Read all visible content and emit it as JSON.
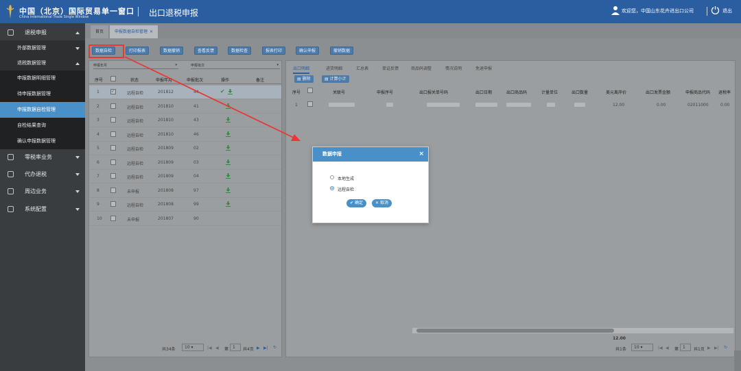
{
  "header": {
    "title": "中国（北京）国际贸易单一窗口",
    "subtitle": "China International Trade Single Window",
    "module": "出口退税申报",
    "welcome": "欢迎您，中国山东花卉进出口公司",
    "logout": "退出"
  },
  "sidebar": {
    "items": [
      {
        "label": "退税申报"
      },
      {
        "label": "外部数据管理"
      },
      {
        "label": "退税数据管理"
      },
      {
        "label": "申报数据明细管理"
      },
      {
        "label": "待申报数据管理"
      },
      {
        "label": "申报数据自检管理"
      },
      {
        "label": "自检结果查询"
      },
      {
        "label": "确认申报数据管理"
      },
      {
        "label": "零税率业务"
      },
      {
        "label": "代办退税"
      },
      {
        "label": "周边业务"
      },
      {
        "label": "系统配置"
      }
    ]
  },
  "tabs": {
    "home": "首页",
    "current": "申报数据自检管理"
  },
  "toolbar": [
    {
      "label": "数据自检"
    },
    {
      "label": "打印报表"
    },
    {
      "label": "数据撤销"
    },
    {
      "label": "查看反馈"
    },
    {
      "label": "数据检查"
    },
    {
      "label": "报表打印"
    },
    {
      "label": "确认申报"
    },
    {
      "label": "撤销数据"
    }
  ],
  "left": {
    "filter1": "申报年月",
    "filter2": "申报批次",
    "headers": {
      "no": "序号",
      "status": "状态",
      "ym": "申报年月",
      "batch": "申报批次",
      "op": "操作",
      "note": "备注"
    },
    "rows": [
      {
        "no": "1",
        "status": "远程自检",
        "ym": "201812",
        "batch": "44",
        "dl": true,
        "check": true,
        "checked": true
      },
      {
        "no": "2",
        "status": "远程自检",
        "ym": "201810",
        "batch": "41",
        "dl": true
      },
      {
        "no": "3",
        "status": "远程自检",
        "ym": "201810",
        "batch": "43",
        "dl": true
      },
      {
        "no": "4",
        "status": "远程自检",
        "ym": "201810",
        "batch": "46",
        "dl": true
      },
      {
        "no": "5",
        "status": "远程自检",
        "ym": "201809",
        "batch": "02",
        "dl": true
      },
      {
        "no": "6",
        "status": "远程自检",
        "ym": "201809",
        "batch": "03",
        "dl": true
      },
      {
        "no": "7",
        "status": "远程自检",
        "ym": "201809",
        "batch": "04",
        "dl": true
      },
      {
        "no": "8",
        "status": "未申报",
        "ym": "201808",
        "batch": "97",
        "dl": true
      },
      {
        "no": "9",
        "status": "远程自检",
        "ym": "201808",
        "batch": "99",
        "dl": true
      },
      {
        "no": "10",
        "status": "未申报",
        "ym": "201807",
        "batch": "90",
        "dl": false
      }
    ],
    "footer": {
      "total": "共34条",
      "pagesize": "10",
      "page_prefix": "第",
      "page": "1",
      "page_total": "共4页"
    }
  },
  "right": {
    "tabs": [
      "出口明细",
      "进货明细",
      "汇总表",
      "单证反馈",
      "商品码调整",
      "情况说明",
      "免退申报"
    ],
    "buttons": [
      "删除",
      "计算小计"
    ],
    "headers": [
      "序号",
      "关联号",
      "申报序号",
      "出口报关单号码",
      "出口日期",
      "出口商品码",
      "计量单位",
      "出口数量",
      "美元离岸价",
      "出口发票金额",
      "申报商品代码",
      "退税率"
    ],
    "row": {
      "no": "1",
      "usd": "12.00",
      "inv": "0.00",
      "code": "02011000",
      "rate": "0.00"
    },
    "sum": "12.00",
    "footer": {
      "total": "共1条",
      "pagesize": "10",
      "page_prefix": "第",
      "page": "1",
      "page_total": "共1页"
    }
  },
  "modal": {
    "title": "数据申报",
    "close": "×",
    "opt1": "本地生成",
    "opt2": "远程自检",
    "selected": "远程自检",
    "ok": "确定",
    "cancel": "取消"
  },
  "colors": {
    "accent": "#2b5ea0",
    "highlight": "#e53935",
    "download": "#2e8b3a"
  }
}
